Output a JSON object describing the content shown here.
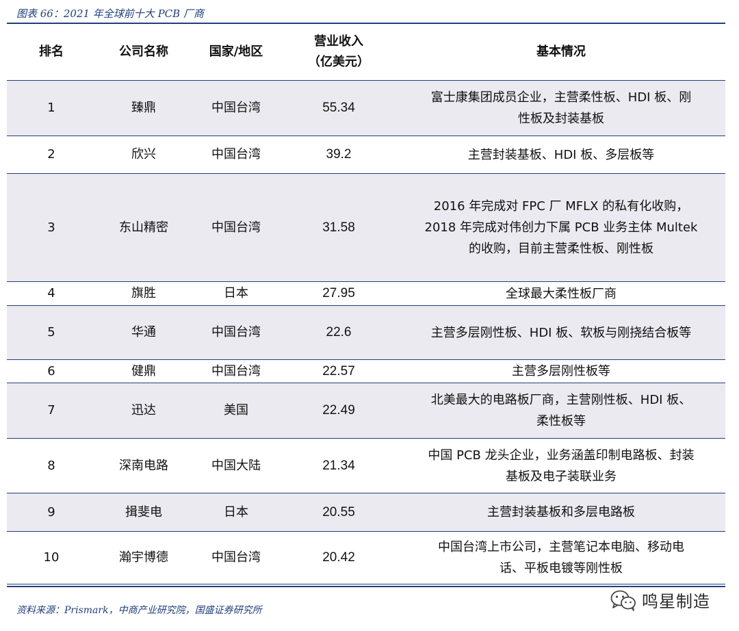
{
  "caption": "图表 66：2021 年全球前十大 PCB 厂商",
  "headers": {
    "rank": "排名",
    "company": "公司名称",
    "region": "国家/地区",
    "revenue_line1": "营业收入",
    "revenue_line2": "（亿美元）",
    "info": "基本情况"
  },
  "rows": [
    {
      "rank": "1",
      "company": "臻鼎",
      "region": "中国台湾",
      "revenue": "55.34",
      "info1": "富士康集团成员企业，主营柔性板、HDI 板、刚",
      "info2": "性板及封装基板"
    },
    {
      "rank": "2",
      "company": "欣兴",
      "region": "中国台湾",
      "revenue": "39.2",
      "info1": "主营封装基板、HDI 板、多层板等"
    },
    {
      "rank": "3",
      "company": "东山精密",
      "region": "中国台湾",
      "revenue": "31.58",
      "info1": "2016 年完成对 FPC 厂 MFLX 的私有化收购，",
      "info2": "2018 年完成对伟创力下属 PCB 业务主体 Multek",
      "info3": "的收购，目前主营柔性板、刚性板"
    },
    {
      "rank": "4",
      "company": "旗胜",
      "region": "日本",
      "revenue": "27.95",
      "info1": "全球最大柔性板厂商"
    },
    {
      "rank": "5",
      "company": "华通",
      "region": "中国台湾",
      "revenue": "22.6",
      "info1": "主营多层刚性板、HDI 板、软板与刚挠结合板等"
    },
    {
      "rank": "6",
      "company": "健鼎",
      "region": "中国台湾",
      "revenue": "22.57",
      "info1": "主营多层刚性板等"
    },
    {
      "rank": "7",
      "company": "迅达",
      "region": "美国",
      "revenue": "22.49",
      "info1": "北美最大的电路板厂商，主营刚性板、HDI 板、",
      "info2": "柔性板等"
    },
    {
      "rank": "8",
      "company": "深南电路",
      "region": "中国大陆",
      "revenue": "21.34",
      "info1": "中国 PCB 龙头企业，业务涵盖印制电路板、封装",
      "info2": "基板及电子装联业务"
    },
    {
      "rank": "9",
      "company": "揖斐电",
      "region": "日本",
      "revenue": "20.55",
      "info1": "主营封装基板和多层电路板"
    },
    {
      "rank": "10",
      "company": "瀚宇博德",
      "region": "中国台湾",
      "revenue": "20.42",
      "info1": "中国台湾上市公司，主营笔记本电脑、移动电",
      "info2": "话、平板电镀等刚性板"
    }
  ],
  "watermark": "鸣星制造",
  "source": "资料来源：Prismark，中商产业研究院，国盛证券研究所"
}
